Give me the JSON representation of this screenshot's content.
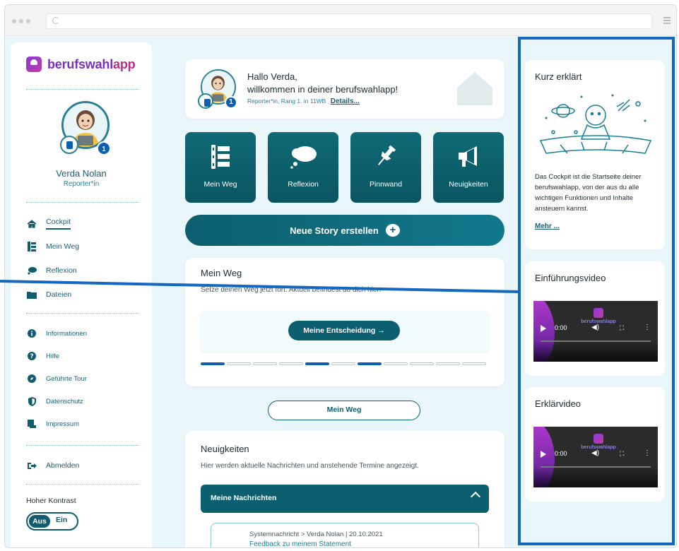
{
  "app": {
    "logo_text_a": "berufswahl",
    "logo_text_b": "app"
  },
  "user": {
    "name": "Verda Nolan",
    "role": "Reporter*in",
    "badge_number": "1"
  },
  "sidebar": {
    "primary_nav": [
      {
        "label": "Cockpit",
        "icon": "home-icon"
      },
      {
        "label": "Mein Weg",
        "icon": "path-icon"
      },
      {
        "label": "Reflexion",
        "icon": "bubble-icon"
      },
      {
        "label": "Dateien",
        "icon": "folder-icon"
      }
    ],
    "secondary_nav": [
      {
        "label": "Informationen",
        "icon": "info-icon"
      },
      {
        "label": "Hilfe",
        "icon": "help-icon"
      },
      {
        "label": "Geführte Tour",
        "icon": "compass-icon"
      },
      {
        "label": "Datenschutz",
        "icon": "shield-icon"
      },
      {
        "label": "Impressum",
        "icon": "book-icon"
      }
    ],
    "logout_label": "Abmelden",
    "contrast_label": "Hoher Kontrast",
    "contrast_off": "Aus",
    "contrast_on": "Ein"
  },
  "welcome": {
    "line1": "Hallo Verda,",
    "line2": "willkommen in deiner berufswahlapp!",
    "meta": "Reporter*in, Rang 1. in 11WB",
    "details_link": "Details..."
  },
  "tiles": [
    {
      "label": "Mein Weg",
      "icon": "path-icon"
    },
    {
      "label": "Reflexion",
      "icon": "thought-bubble-icon"
    },
    {
      "label": "Pinnwand",
      "icon": "pin-icon"
    },
    {
      "label": "Neuigkeiten",
      "icon": "megaphone-icon"
    }
  ],
  "new_story_button": "Neue Story erstellen",
  "mein_weg": {
    "title": "Mein Weg",
    "subtitle": "Setze deinen Weg jetzt fort. Aktuell befindest du dich hier:",
    "decision_button": "Meine Entscheidung →",
    "progress_steps": [
      true,
      false,
      false,
      false,
      true,
      false,
      true,
      false,
      false,
      false,
      false
    ],
    "link_button": "Mein Weg"
  },
  "news": {
    "title": "Neuigkeiten",
    "subtitle": "Hier werden aktuelle Nachrichten und anstehende Termine angezeigt.",
    "accordion_label": "Meine Nachrichten",
    "message_meta": "Systemnachricht > Verda Nolan | 20.10.2021",
    "message_title": "Feedback zu meinem Statement"
  },
  "right": {
    "explained_title": "Kurz erklärt",
    "explained_text": "Das Cockpit ist die Startseite deiner berufswahlapp, von der aus du alle wichtigen Funktionen und Inhalte ansteuern kannst.",
    "more_link": "Mehr ...",
    "intro_video_title": "Einführungsvideo",
    "explain_video_title": "Erklärvideo",
    "video_time": "0:00",
    "video_logo_text": "berufswahlapp"
  },
  "colors": {
    "primary": "#0c5f6e",
    "highlight": "#1468c0",
    "background": "#eaf7fa"
  }
}
